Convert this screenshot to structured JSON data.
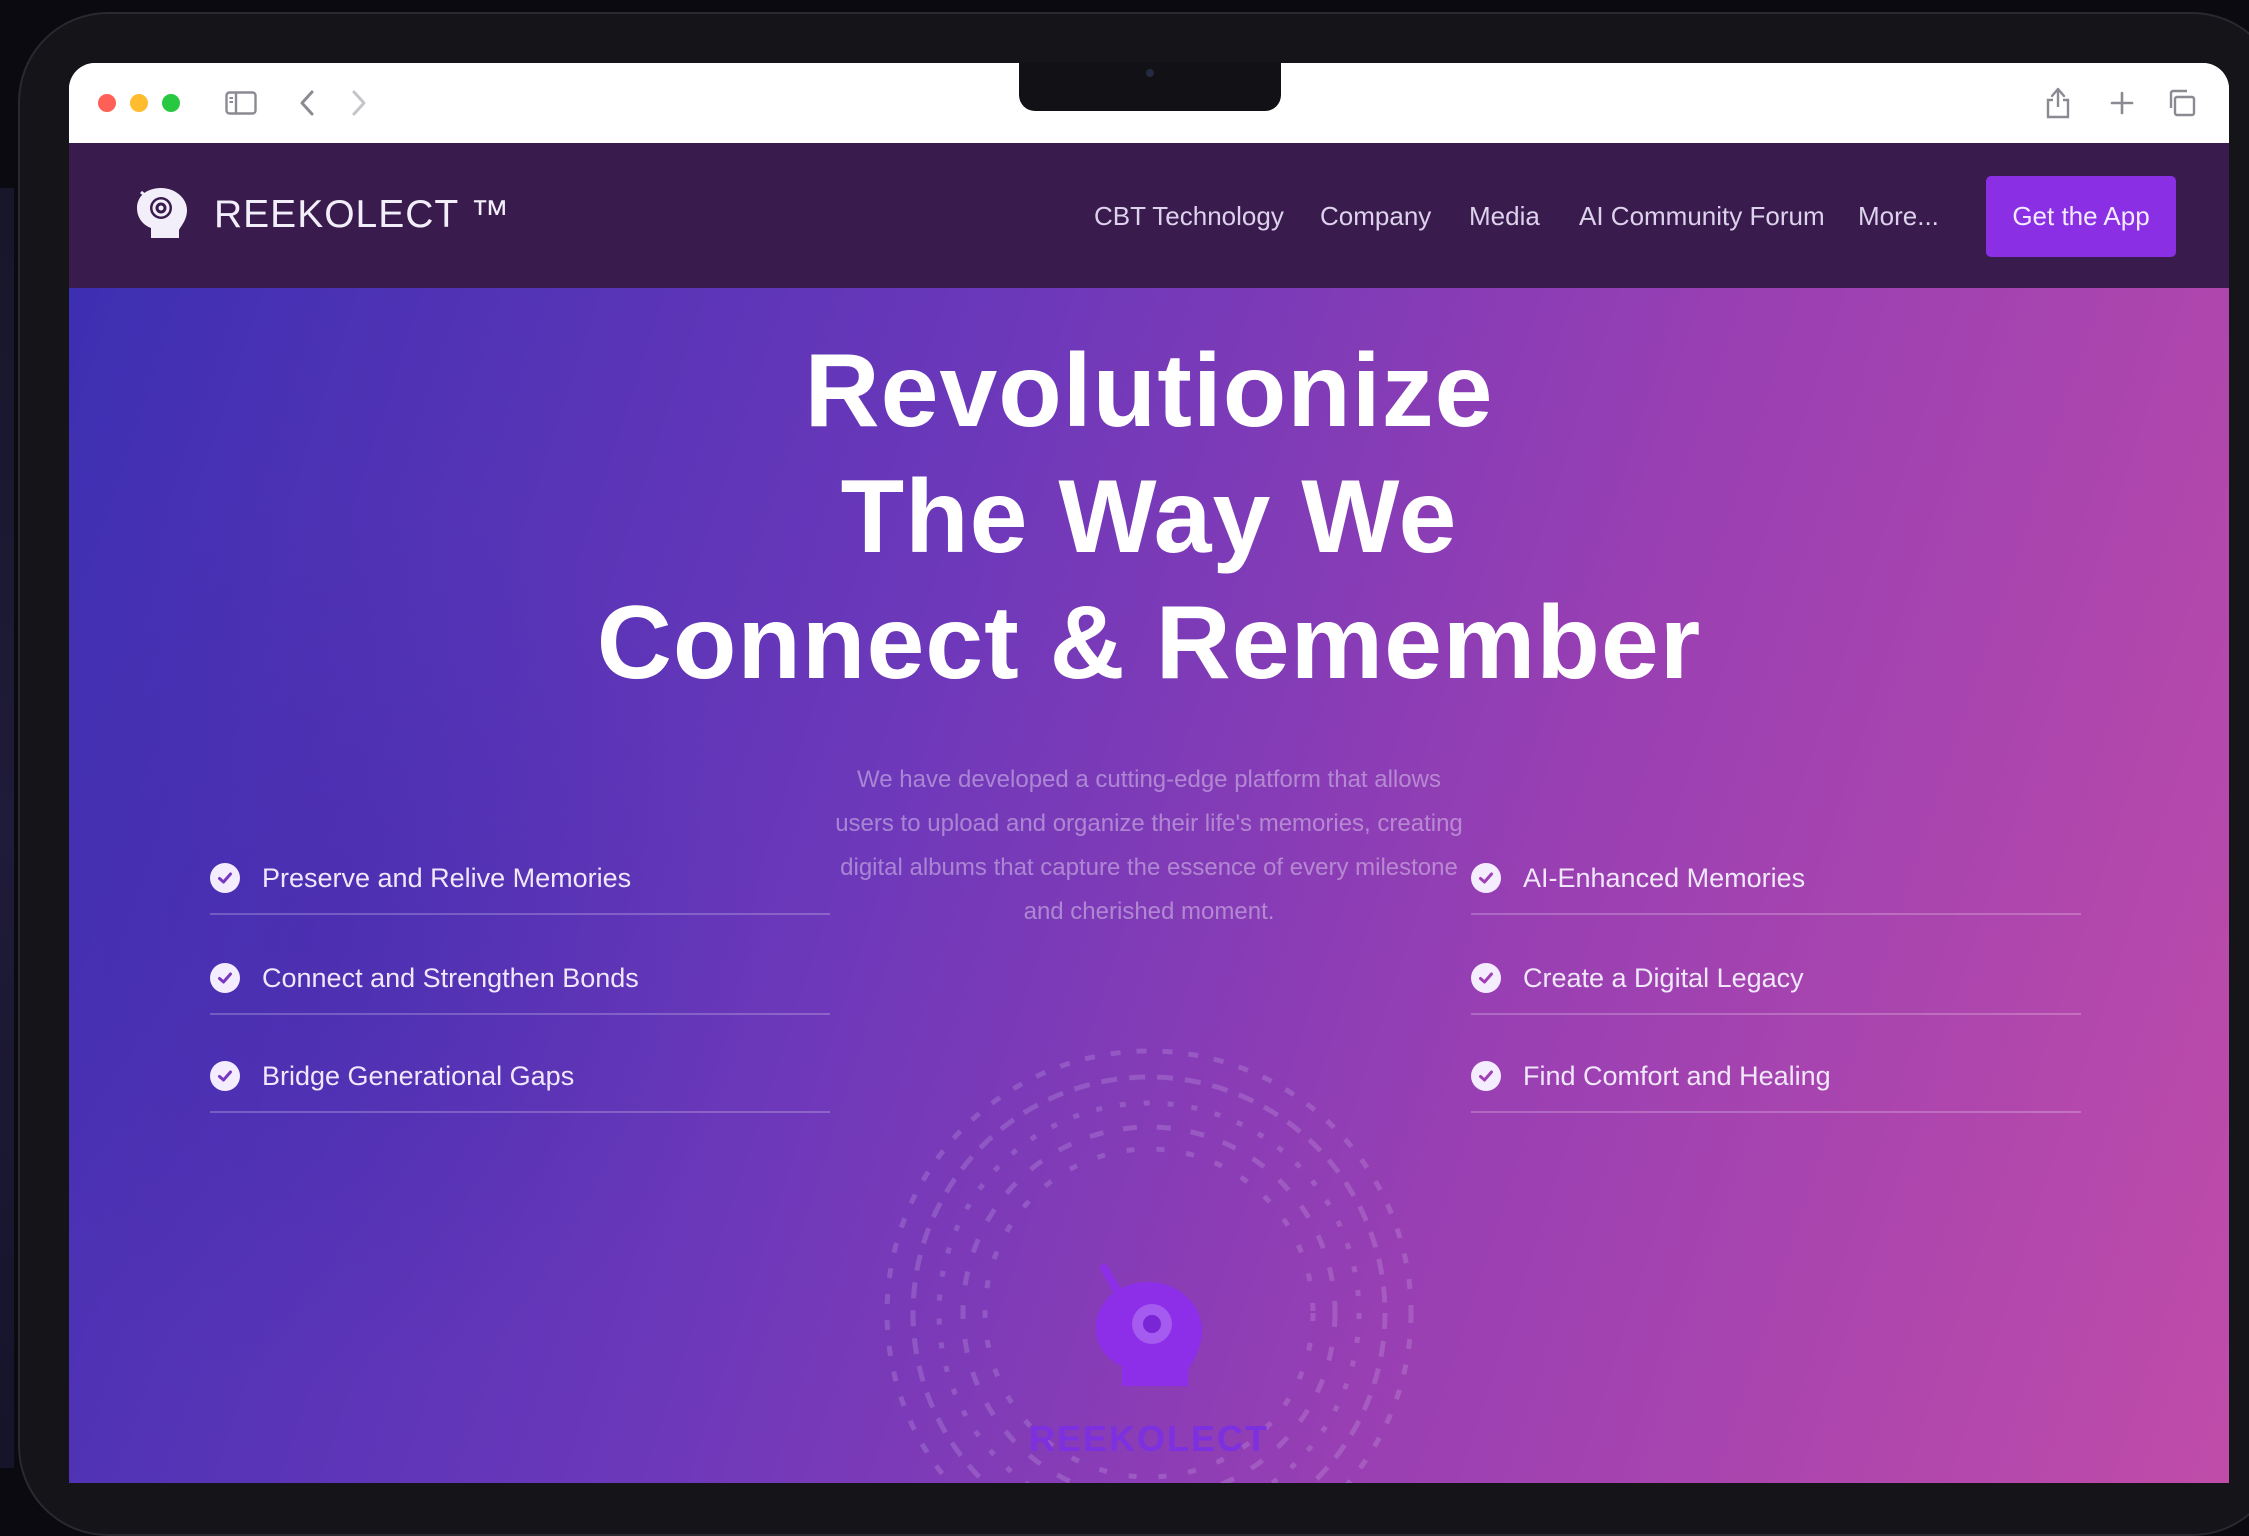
{
  "brand": {
    "name": "REEKOLECT ™",
    "accent": "#8a2fe4",
    "nav_bg": "#3a1b4e"
  },
  "nav": {
    "links": [
      "CBT Technology",
      "Company",
      "Media",
      "AI Community Forum",
      "More..."
    ],
    "cta": "Get the App"
  },
  "hero": {
    "headline_lines": [
      "Revolutionize",
      "The Way We",
      "Connect & Remember"
    ],
    "subtext_lines": [
      "We have developed a cutting-edge platform that allows",
      "users to upload and organize their life's memories, creating",
      "digital albums that capture the essence of every milestone",
      "and cherished moment."
    ],
    "graphic_label": "REEKOLECT",
    "gradient": [
      "#3d2fb2",
      "#6d38ba",
      "#983fb3",
      "#c04ca9"
    ]
  },
  "features": {
    "left": [
      "Preserve and Relive Memories",
      "Connect and Strengthen Bonds",
      "Bridge Generational Gaps"
    ],
    "right": [
      "AI-Enhanced Memories",
      "Create a Digital Legacy",
      "Find Comfort and Healing"
    ]
  },
  "browser": {
    "icons": [
      "sidebar-icon",
      "back-icon",
      "forward-icon",
      "share-icon",
      "new-tab-icon",
      "tabs-icon"
    ]
  }
}
